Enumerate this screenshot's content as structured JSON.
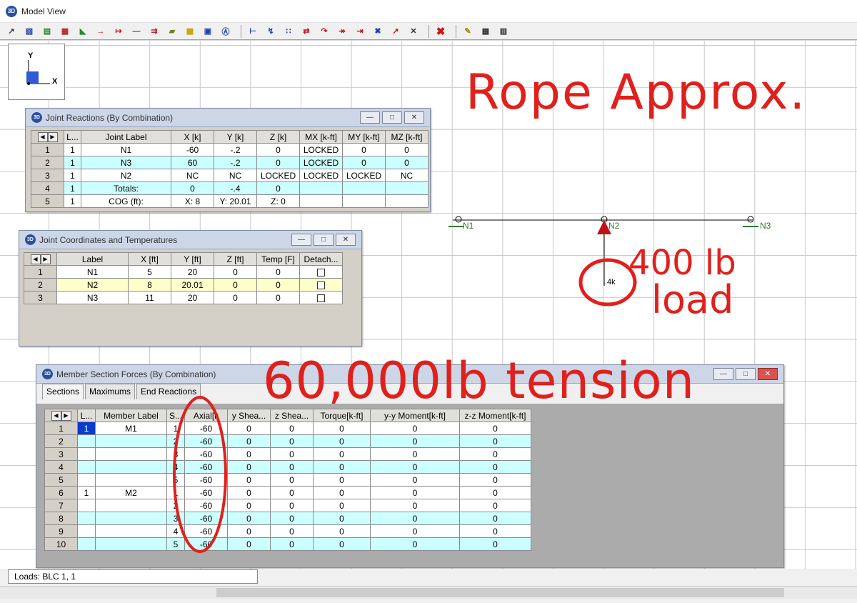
{
  "window": {
    "app_icon": "3D",
    "title": "Model View"
  },
  "toolbar": {
    "icons": [
      "select-icon",
      "draw-members-icon",
      "boundary-icon",
      "plate-icon",
      "area-load-icon",
      "point-load-icon",
      "line-load-icon",
      "dist-load-icon",
      "moving-load-icon",
      "surface-icon",
      "solid-icon",
      "wall-icon",
      "rotate-icon",
      "label-icon",
      "snap-icon",
      "merge-icon",
      "move-icon",
      "copy-icon",
      "split-icon",
      "align-icon",
      "cross-icon",
      "x-icon",
      "delete-icon",
      "edit-icon",
      "grid-icon",
      "table-icon"
    ]
  },
  "axis": {
    "y": "Y",
    "x": "X"
  },
  "joint_reactions": {
    "app_icon": "3D",
    "title": "Joint Reactions (By Combination)",
    "headers": [
      "L...",
      "Joint Label",
      "X [k]",
      "Y [k]",
      "Z [k]",
      "MX [k-ft]",
      "MY [k-ft]",
      "MZ [k-ft]"
    ],
    "rows": [
      {
        "n": "1",
        "c": [
          "1",
          "N1",
          "-60",
          "-.2",
          "0",
          "LOCKED",
          "0",
          "0"
        ]
      },
      {
        "n": "2",
        "c": [
          "1",
          "N3",
          "60",
          "-.2",
          "0",
          "LOCKED",
          "0",
          "0"
        ]
      },
      {
        "n": "3",
        "c": [
          "1",
          "N2",
          "NC",
          "NC",
          "LOCKED",
          "LOCKED",
          "LOCKED",
          "NC"
        ]
      },
      {
        "n": "4",
        "c": [
          "1",
          "Totals:",
          "0",
          "-.4",
          "0",
          "",
          "",
          ""
        ]
      },
      {
        "n": "5",
        "c": [
          "1",
          "COG (ft):",
          "X: 8",
          "Y: 20.01",
          "Z: 0",
          "",
          "",
          ""
        ]
      }
    ]
  },
  "joint_coords": {
    "app_icon": "3D",
    "title": "Joint Coordinates and Temperatures",
    "headers": [
      "Label",
      "X [ft]",
      "Y [ft]",
      "Z [ft]",
      "Temp [F]",
      "Detach..."
    ],
    "rows": [
      {
        "n": "1",
        "c": [
          "N1",
          "5",
          "20",
          "0",
          "0"
        ]
      },
      {
        "n": "2",
        "c": [
          "N2",
          "8",
          "20.01",
          "0",
          "0"
        ]
      },
      {
        "n": "3",
        "c": [
          "N3",
          "11",
          "20",
          "0",
          "0"
        ]
      }
    ]
  },
  "member_forces": {
    "app_icon": "3D",
    "title": "Member Section Forces (By Combination)",
    "tabs": [
      "Sections",
      "Maximums",
      "End Reactions"
    ],
    "headers": [
      "L...",
      "Member Label",
      "S...",
      "Axial[k",
      "y Shea...",
      "z Shea...",
      "Torque[k-ft]",
      "y-y Moment[k-ft]",
      "z-z Moment[k-ft]"
    ],
    "rows": [
      {
        "n": "1",
        "c": [
          "1",
          "M1",
          "1",
          "-60",
          "0",
          "0",
          "0",
          "0",
          "0"
        ]
      },
      {
        "n": "2",
        "c": [
          "",
          "",
          "2",
          "-60",
          "0",
          "0",
          "0",
          "0",
          "0"
        ]
      },
      {
        "n": "3",
        "c": [
          "",
          "",
          "3",
          "-60",
          "0",
          "0",
          "0",
          "0",
          "0"
        ]
      },
      {
        "n": "4",
        "c": [
          "",
          "",
          "4",
          "-60",
          "0",
          "0",
          "0",
          "0",
          "0"
        ]
      },
      {
        "n": "5",
        "c": [
          "",
          "",
          "5",
          "-60",
          "0",
          "0",
          "0",
          "0",
          "0"
        ]
      },
      {
        "n": "6",
        "c": [
          "1",
          "M2",
          "1",
          "-60",
          "0",
          "0",
          "0",
          "0",
          "0"
        ]
      },
      {
        "n": "7",
        "c": [
          "",
          "",
          "2",
          "-60",
          "0",
          "0",
          "0",
          "0",
          "0"
        ]
      },
      {
        "n": "8",
        "c": [
          "",
          "",
          "3",
          "-60",
          "0",
          "0",
          "0",
          "0",
          "0"
        ]
      },
      {
        "n": "9",
        "c": [
          "",
          "",
          "4",
          "-60",
          "0",
          "0",
          "0",
          "0",
          "0"
        ]
      },
      {
        "n": "10",
        "c": [
          "",
          "",
          "5",
          "-60",
          "0",
          "0",
          "0",
          "0",
          "0"
        ]
      }
    ]
  },
  "model": {
    "nodes": [
      "N1",
      "N2",
      "N3"
    ],
    "load_label": ".4k"
  },
  "annotations": {
    "rope": "Rope Approx.",
    "load_line1": "400 lb",
    "load_line2": "load",
    "tension": "60,000lb tension"
  },
  "status": {
    "loads": "Loads: BLC 1, 1"
  },
  "colors": {
    "handwriting": "#e0201c",
    "cyan_row": "#ccffff",
    "yellow_row": "#ffffcc",
    "node_green": "#2e7d32",
    "load_red": "#c0111b"
  }
}
